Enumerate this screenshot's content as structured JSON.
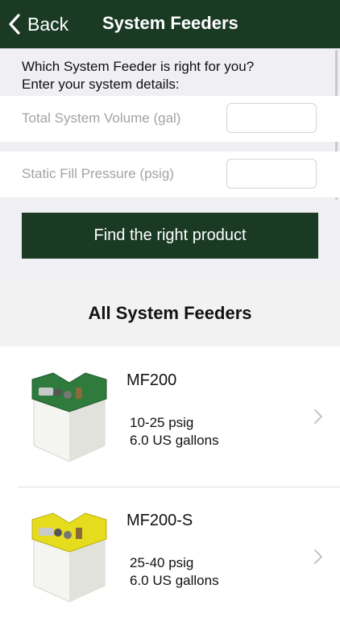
{
  "nav": {
    "back_label": "Back",
    "title": "System Feeders",
    "color": "#1b3a24"
  },
  "form": {
    "intro_line1": "Which System Feeder is right for you?",
    "intro_line2": "Enter your system details:",
    "volume_label": "Total System Volume (gal)",
    "volume_value": "",
    "pressure_label": "Static Fill Pressure (psig)",
    "pressure_value": "",
    "submit_label": "Find the right product"
  },
  "list": {
    "header": "All System Feeders",
    "items": [
      {
        "name": "MF200",
        "pressure": "10-25 psig",
        "capacity": "6.0 US gallons",
        "lid_color": "#2f7a3d"
      },
      {
        "name": "MF200-S",
        "pressure": "25-40 psig",
        "capacity": "6.0 US gallons",
        "lid_color": "#e6dc1e"
      }
    ]
  }
}
